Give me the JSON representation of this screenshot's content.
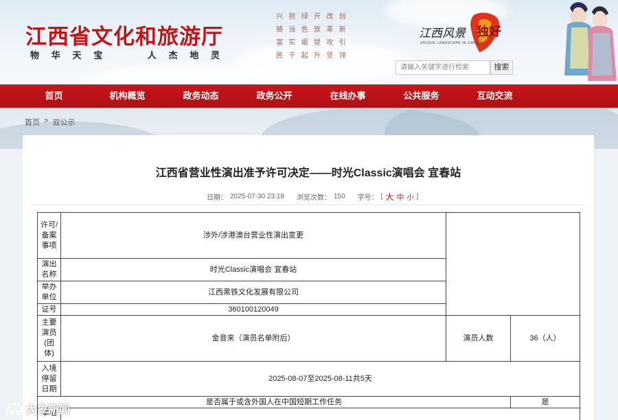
{
  "header": {
    "site_title": "江西省文化和旅游厅",
    "slogan": [
      "物",
      "华",
      "天",
      "宝",
      "人",
      "杰",
      "地",
      "灵"
    ],
    "poem": [
      "兴",
      "担",
      "绿",
      "开",
      "改",
      "创",
      "赣",
      "当",
      "色",
      "放",
      "革",
      "新",
      "富",
      "实",
      "崛",
      "提",
      "攻",
      "引",
      "民",
      "干",
      "起",
      "升",
      "坚",
      "领"
    ],
    "brand_text": "江西风景",
    "brand_mark": "独好",
    "brand_sub": "UNIQUE LANDSCAPE IN JIANGXI",
    "search": {
      "placeholder": "请输入关键字进行检索",
      "button": "搜索"
    }
  },
  "nav": [
    "首页",
    "机构概览",
    "政务动态",
    "政务公开",
    "在线办事",
    "公共服务",
    "互动交流"
  ],
  "breadcrumb": {
    "home": "首页",
    "sep": ">",
    "current": "双公示"
  },
  "article": {
    "title": "江西省营业性演出准予许可决定——时光Classic演唱会 宜春站",
    "date_label": "日期：",
    "date": "2025-07-30 23:18",
    "views_label": "浏览次数：",
    "views": "150",
    "font_label": "字号：",
    "font_open": "[",
    "font_big": "大",
    "font_mid": "中",
    "font_small": "小",
    "font_close": "]"
  },
  "table": {
    "permit_label": "许可/备案事项",
    "permit_value": "涉外/涉港澳台营业性演出变更",
    "show_label": "演出名称",
    "show_value": "时光Classic演唱会 宜春站",
    "organizer_label": "举办单位",
    "organizer_value": "江西黑铁文化发展有限公司",
    "cert_label": "证号",
    "cert_value": "360100120049",
    "performers_label": "主要演员(团体)",
    "performers_value": "金音来（演员名单附后）",
    "count_label": "演员人数",
    "count_value": "36（人）",
    "entry_label": "入境停留日期",
    "entry_value": "2025-08-07至2025-08-11共5天",
    "work_question": "是否属于或含外国人在中国短期工作任务",
    "work_answer": "是",
    "local_label": "本地"
  },
  "watermark": "大象新闻"
}
